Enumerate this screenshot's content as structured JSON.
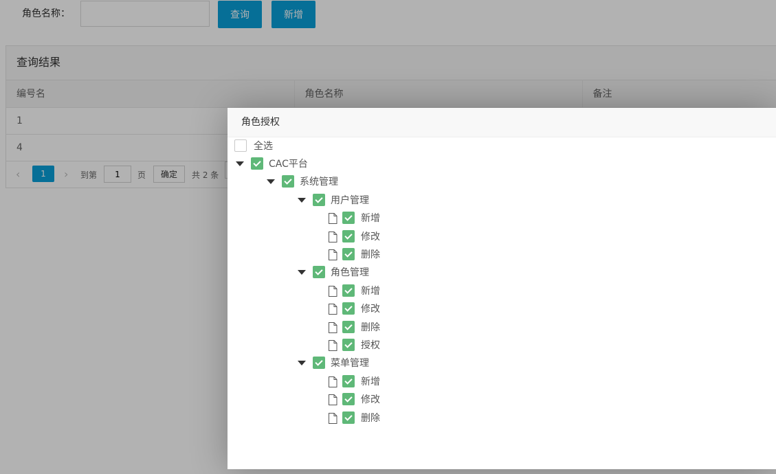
{
  "search": {
    "label": "角色名称：",
    "input_value": "",
    "query_label": "查询",
    "add_label": "新增"
  },
  "results": {
    "title": "查询结果",
    "columns": [
      "编号名",
      "角色名称",
      "备注"
    ],
    "rows": [
      [
        "1",
        "",
        ""
      ],
      [
        "4",
        "",
        ""
      ]
    ],
    "pager": {
      "current_page": "1",
      "goto_label": "到第",
      "goto_value": "1",
      "page_unit": "页",
      "confirm_label": "确定",
      "total_label": "共 2 条"
    }
  },
  "dialog": {
    "title": "角色授权",
    "select_all_label": "全选",
    "select_all_checked": false,
    "tree": [
      {
        "label": "CAC平台",
        "level": 0,
        "type": "folder",
        "checked": true
      },
      {
        "label": "系统管理",
        "level": 1,
        "type": "folder",
        "checked": true
      },
      {
        "label": "用户管理",
        "level": 2,
        "type": "folder",
        "checked": true
      },
      {
        "label": "新增",
        "level": 3,
        "type": "leaf",
        "checked": true
      },
      {
        "label": "修改",
        "level": 3,
        "type": "leaf",
        "checked": true
      },
      {
        "label": "删除",
        "level": 3,
        "type": "leaf",
        "checked": true
      },
      {
        "label": "角色管理",
        "level": 2,
        "type": "folder",
        "checked": true
      },
      {
        "label": "新增",
        "level": 3,
        "type": "leaf",
        "checked": true
      },
      {
        "label": "修改",
        "level": 3,
        "type": "leaf",
        "checked": true
      },
      {
        "label": "删除",
        "level": 3,
        "type": "leaf",
        "checked": true
      },
      {
        "label": "授权",
        "level": 3,
        "type": "leaf",
        "checked": true
      },
      {
        "label": "菜单管理",
        "level": 2,
        "type": "folder",
        "checked": true
      },
      {
        "label": "新增",
        "level": 3,
        "type": "leaf",
        "checked": true
      },
      {
        "label": "修改",
        "level": 3,
        "type": "leaf",
        "checked": true
      },
      {
        "label": "删除",
        "level": 3,
        "type": "leaf",
        "checked": true
      }
    ]
  },
  "colors": {
    "primary": "#0a9fd8",
    "check_green": "#5fb878"
  }
}
